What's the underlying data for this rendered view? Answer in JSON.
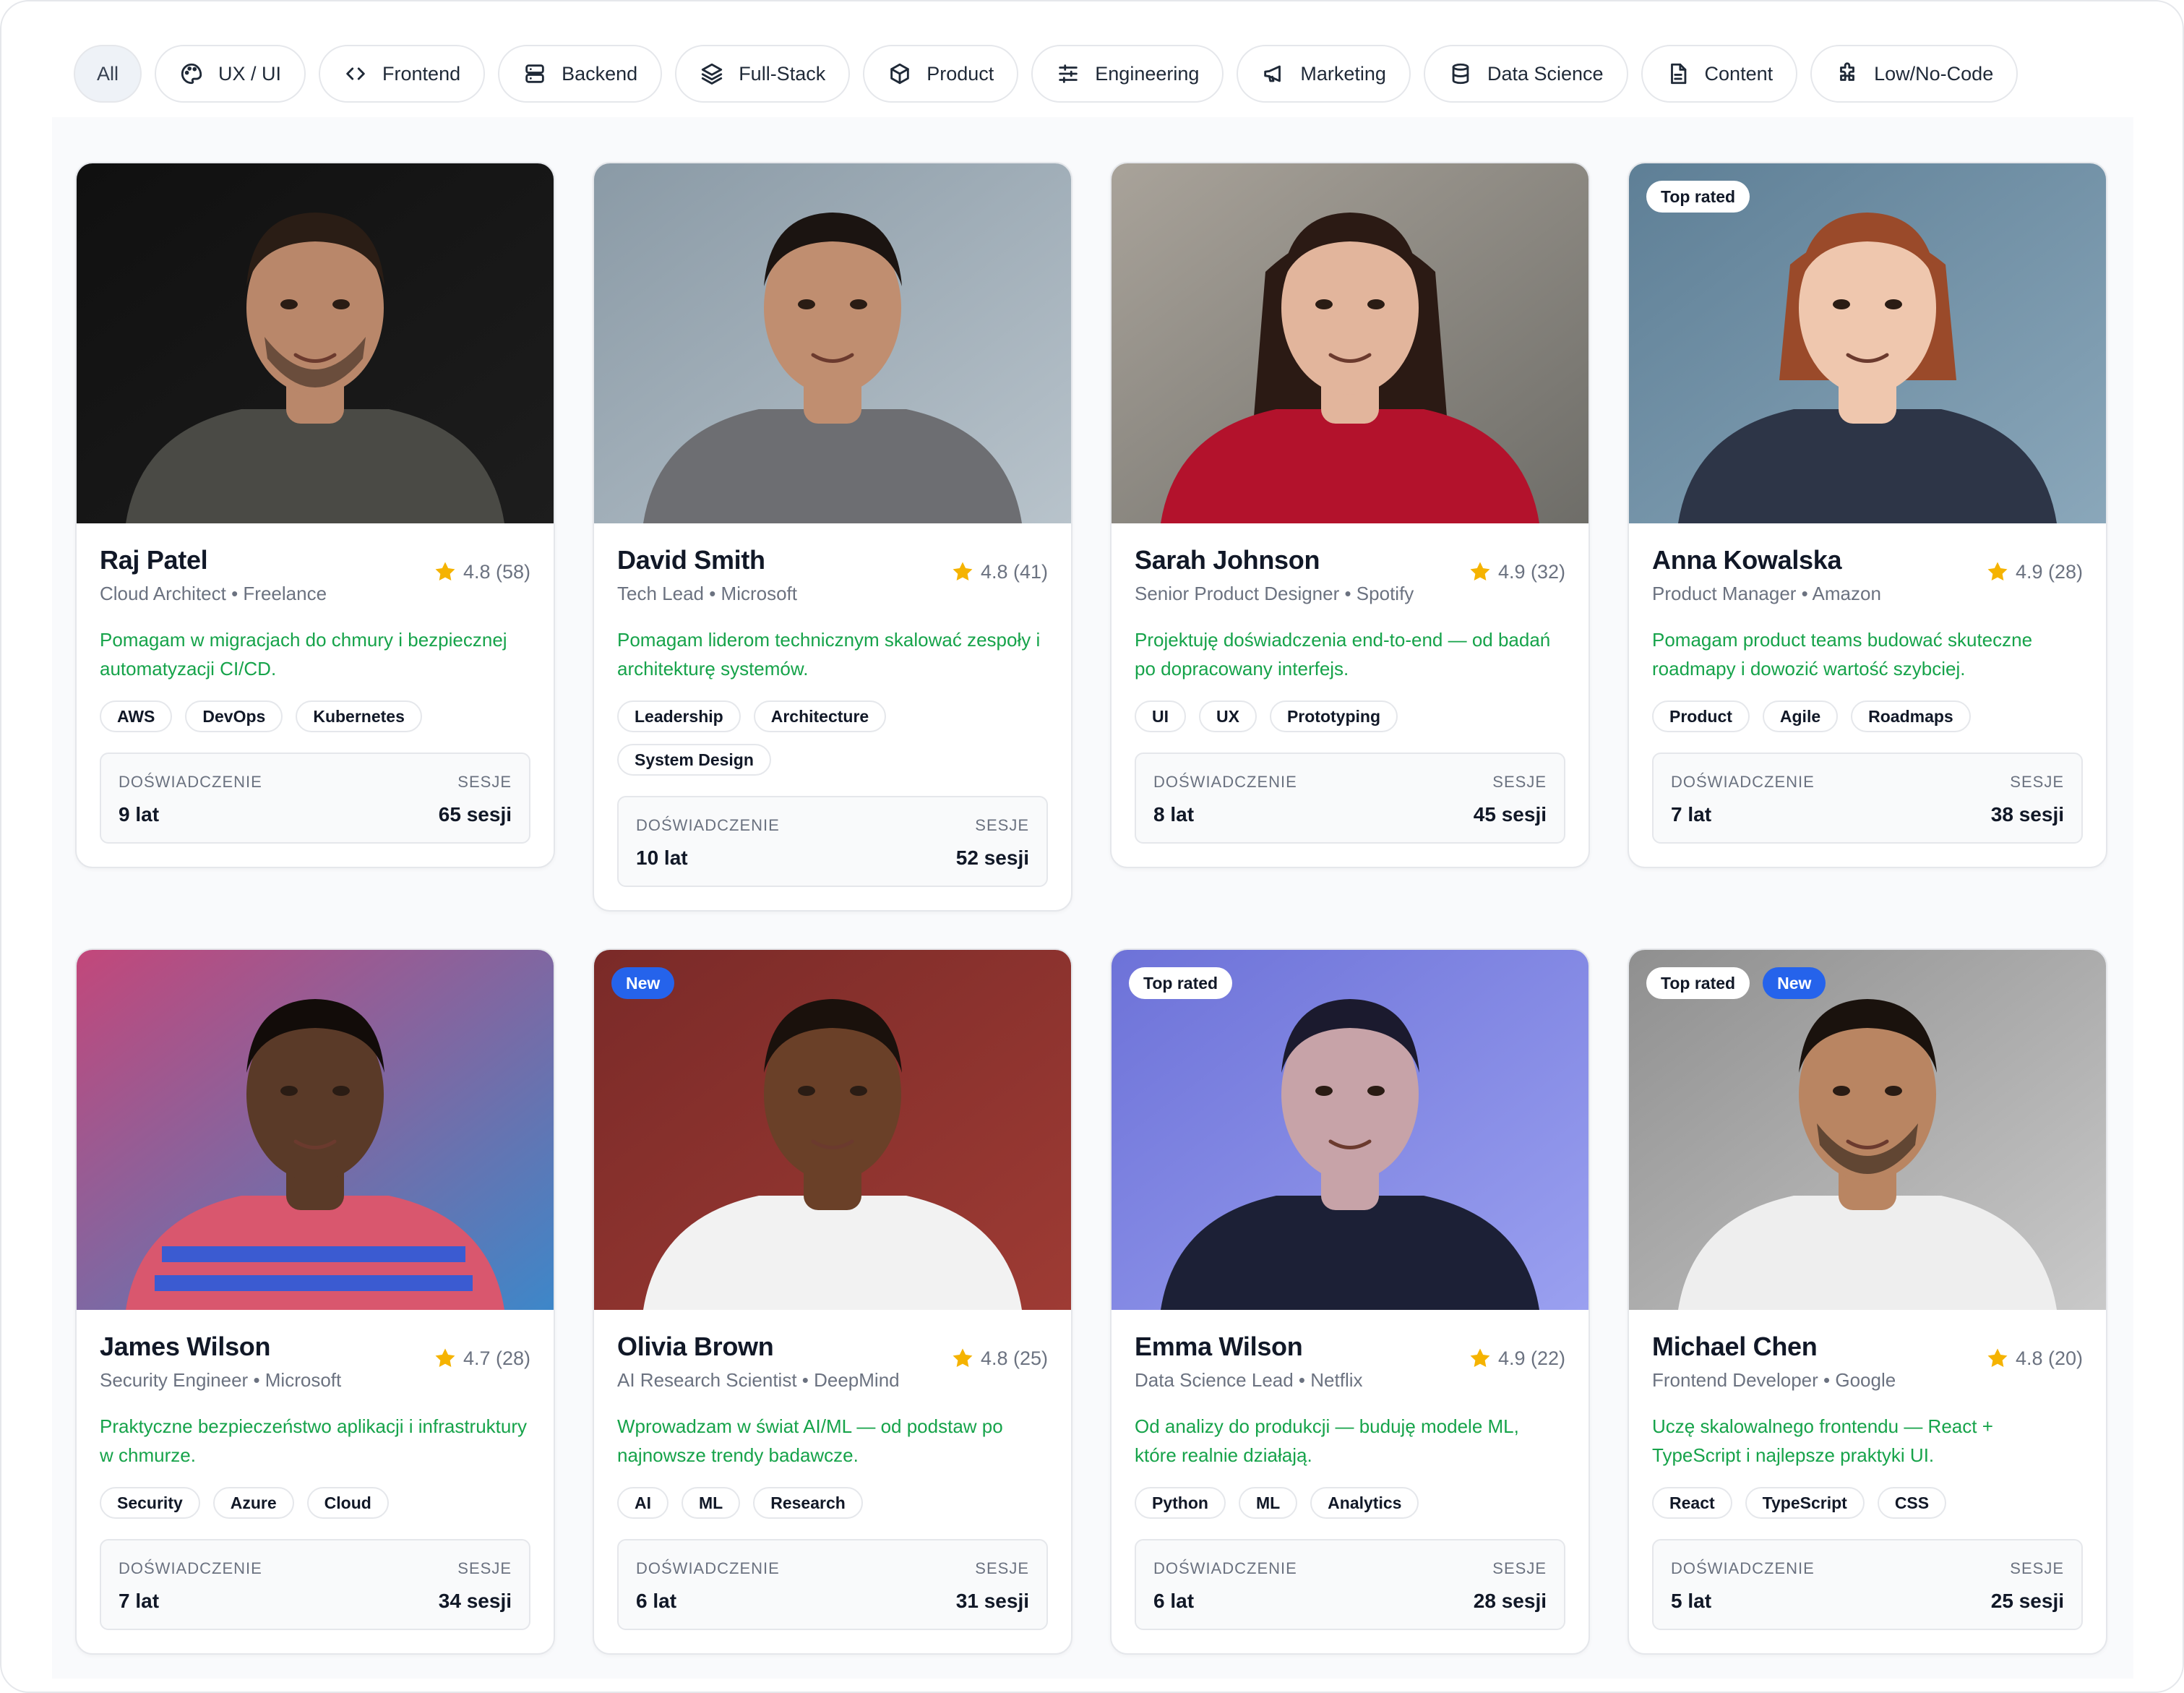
{
  "filters": [
    {
      "label": "All",
      "icon": "",
      "active": true
    },
    {
      "label": "UX / UI",
      "icon": "palette-icon"
    },
    {
      "label": "Frontend",
      "icon": "code-icon"
    },
    {
      "label": "Backend",
      "icon": "server-icon"
    },
    {
      "label": "Full-Stack",
      "icon": "layers-icon"
    },
    {
      "label": "Product",
      "icon": "box-icon"
    },
    {
      "label": "Engineering",
      "icon": "sliders-icon"
    },
    {
      "label": "Marketing",
      "icon": "megaphone-icon"
    },
    {
      "label": "Data Science",
      "icon": "database-icon"
    },
    {
      "label": "Content",
      "icon": "document-icon"
    },
    {
      "label": "Low/No-Code",
      "icon": "puzzle-icon"
    }
  ],
  "stat_labels": {
    "experience": "DOŚWIADCZENIE",
    "sessions": "SESJE"
  },
  "colors": {
    "accent_green": "#16a34a",
    "new_badge": "#2563eb",
    "star": "#f5b301"
  },
  "mentors": [
    {
      "name": "Raj Patel",
      "role": "Cloud Architect • Freelance",
      "rating": "4.8 (58)",
      "description": "Pomagam w migracjach do chmury i bezpiecznej automatyzacji CI/CD.",
      "tags": [
        "AWS",
        "DevOps",
        "Kubernetes"
      ],
      "experience": "9 lat",
      "sessions": "65 sesji",
      "badges": []
    },
    {
      "name": "David Smith",
      "role": "Tech Lead • Microsoft",
      "rating": "4.8 (41)",
      "description": "Pomagam liderom technicznym skalować zespoły i architekturę systemów.",
      "tags": [
        "Leadership",
        "Architecture",
        "System Design"
      ],
      "experience": "10 lat",
      "sessions": "52 sesji",
      "badges": []
    },
    {
      "name": "Sarah Johnson",
      "role": "Senior Product Designer • Spotify",
      "rating": "4.9 (32)",
      "description": "Projektuję doświadczenia end-to-end — od badań po dopracowany interfejs.",
      "tags": [
        "UI",
        "UX",
        "Prototyping"
      ],
      "experience": "8 lat",
      "sessions": "45 sesji",
      "badges": []
    },
    {
      "name": "Anna Kowalska",
      "role": "Product Manager • Amazon",
      "rating": "4.9 (28)",
      "description": "Pomagam product teams budować skuteczne roadmapy i dowozić wartość szybciej.",
      "tags": [
        "Product",
        "Agile",
        "Roadmaps"
      ],
      "experience": "7 lat",
      "sessions": "38 sesji",
      "badges": [
        "Top rated"
      ]
    },
    {
      "name": "James Wilson",
      "role": "Security Engineer • Microsoft",
      "rating": "4.7 (28)",
      "description": "Praktyczne bezpieczeństwo aplikacji i infrastruktury w chmurze.",
      "tags": [
        "Security",
        "Azure",
        "Cloud"
      ],
      "experience": "7 lat",
      "sessions": "34 sesji",
      "badges": []
    },
    {
      "name": "Olivia Brown",
      "role": "AI Research Scientist • DeepMind",
      "rating": "4.8 (25)",
      "description": "Wprowadzam w świat AI/ML — od podstaw po najnowsze trendy badawcze.",
      "tags": [
        "AI",
        "ML",
        "Research"
      ],
      "experience": "6 lat",
      "sessions": "31 sesji",
      "badges": [
        "New"
      ]
    },
    {
      "name": "Emma Wilson",
      "role": "Data Science Lead • Netflix",
      "rating": "4.9 (22)",
      "description": "Od analizy do produkcji — buduję modele ML, które realnie działają.",
      "tags": [
        "Python",
        "ML",
        "Analytics"
      ],
      "experience": "6 lat",
      "sessions": "28 sesji",
      "badges": [
        "Top rated"
      ]
    },
    {
      "name": "Michael Chen",
      "role": "Frontend Developer • Google",
      "rating": "4.8 (20)",
      "description": "Uczę skalowalnego frontendu — React + TypeScript i najlepsze praktyki UI.",
      "tags": [
        "React",
        "TypeScript",
        "CSS"
      ],
      "experience": "5 lat",
      "sessions": "25 sesji",
      "badges": [
        "Top rated",
        "New"
      ]
    }
  ]
}
